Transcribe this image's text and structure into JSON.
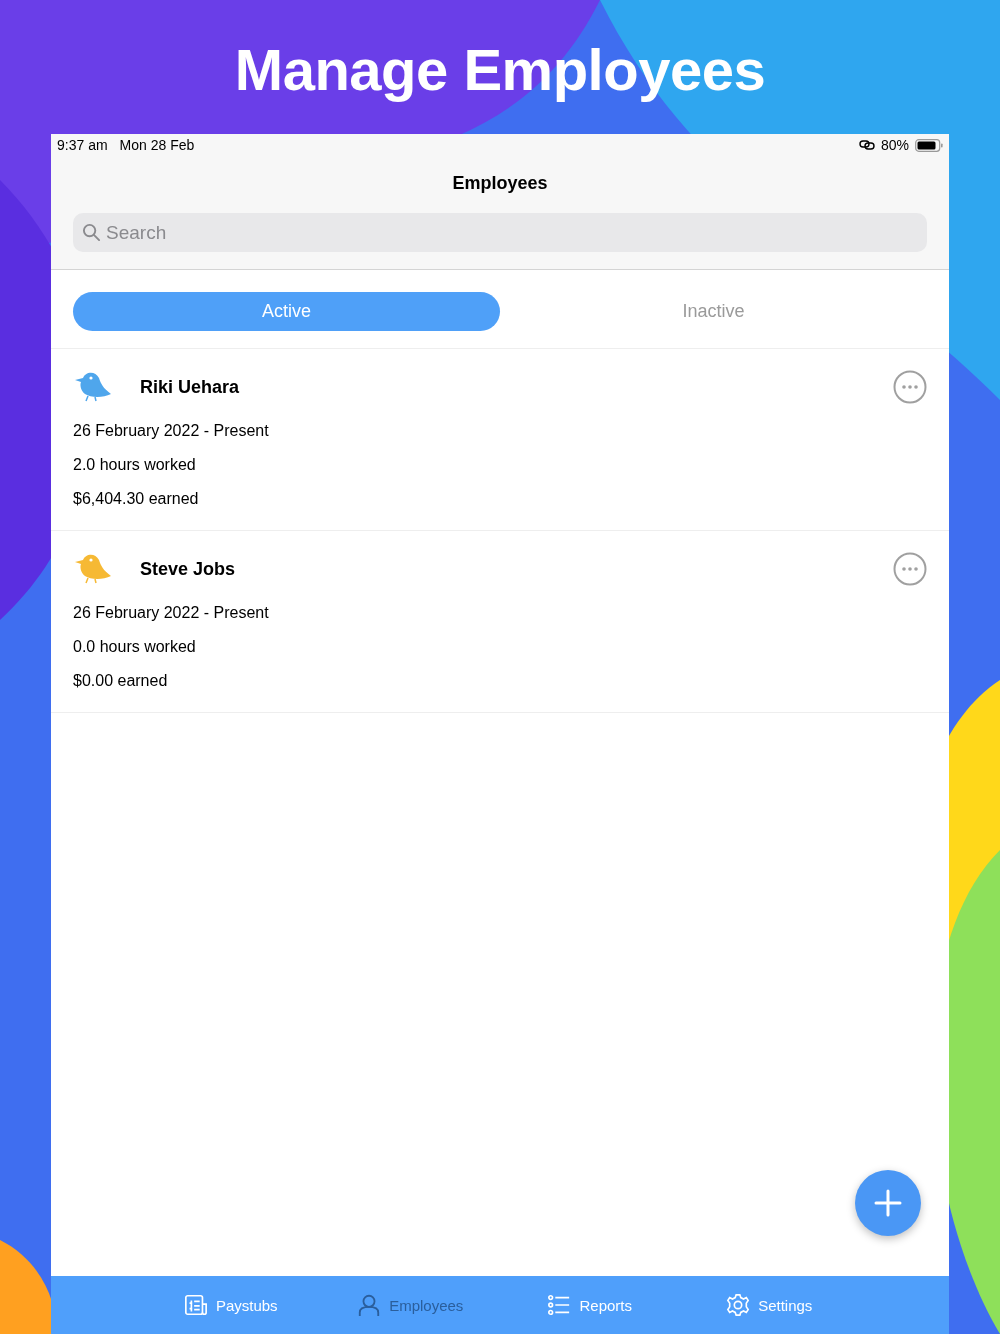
{
  "headline": "Manage Employees",
  "status_bar": {
    "time": "9:37 am",
    "date": "Mon 28 Feb",
    "battery_text": "80%"
  },
  "nav": {
    "title": "Employees"
  },
  "search": {
    "placeholder": "Search"
  },
  "segments": [
    {
      "label": "Active",
      "selected": true
    },
    {
      "label": "Inactive",
      "selected": false
    }
  ],
  "employees": [
    {
      "name": "Riki Uehara",
      "color": "#4fa6ec",
      "period": "26 February 2022 - Present",
      "hours": "2.0 hours worked",
      "earned": "$6,404.30 earned"
    },
    {
      "name": "Steve Jobs",
      "color": "#f6b934",
      "period": "26 February 2022 - Present",
      "hours": "0.0 hours worked",
      "earned": "$0.00 earned"
    }
  ],
  "tab_bar": [
    {
      "kind": "paystubs",
      "label": "Paystubs",
      "selected": false
    },
    {
      "kind": "employees",
      "label": "Employees",
      "selected": true
    },
    {
      "kind": "reports",
      "label": "Reports",
      "selected": false
    },
    {
      "kind": "settings",
      "label": "Settings",
      "selected": false
    }
  ]
}
